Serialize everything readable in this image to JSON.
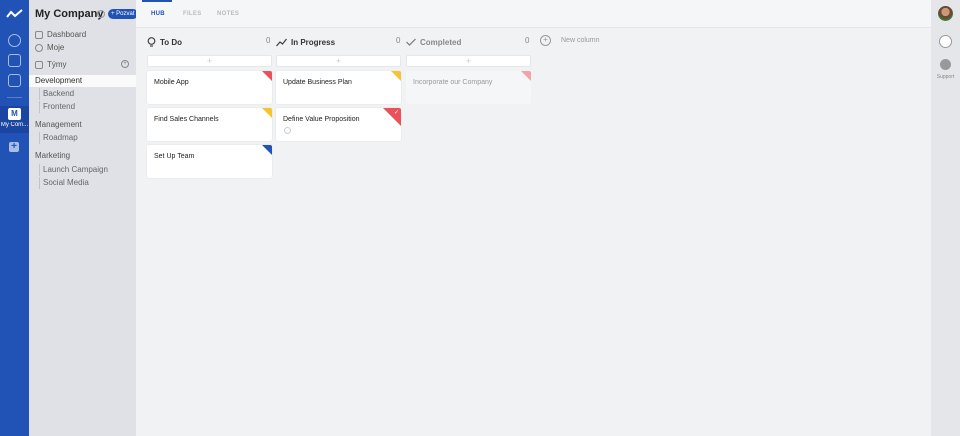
{
  "workspace": {
    "name": "My Company",
    "invite_label": "+ Pozvat",
    "rail_initial": "M",
    "rail_label": "My Com..."
  },
  "sidebar": {
    "dashboard": "Dashboard",
    "mine": "Moje",
    "teams": "Týmy",
    "sections": [
      {
        "name": "Development",
        "items": [
          "Backend",
          "Frontend"
        ]
      },
      {
        "name": "Management",
        "items": [
          "Roadmap"
        ]
      },
      {
        "name": "Marketing",
        "items": [
          "Launch Campaign",
          "Social Media"
        ]
      }
    ]
  },
  "tabs": [
    {
      "label": "HUB"
    },
    {
      "label": "FILES"
    },
    {
      "label": "NOTES"
    }
  ],
  "columns": [
    {
      "title": "To Do",
      "count": "0",
      "icon": "lightbulb-icon",
      "add_label": "+",
      "cards": [
        {
          "title": "Mobile App",
          "color": "#e9525b"
        },
        {
          "title": "Find Sales Channels",
          "color": "#f5c431"
        },
        {
          "title": "Set Up Team",
          "color": "#2152b5"
        }
      ]
    },
    {
      "title": "In Progress",
      "count": "0",
      "icon": "trend-icon",
      "add_label": "+",
      "cards": [
        {
          "title": "Update Business Plan",
          "color": "#f5c431"
        },
        {
          "title": "Define Value Proposition",
          "color": "#e9525b",
          "checked": true
        }
      ]
    },
    {
      "title": "Completed",
      "count": "0",
      "icon": "check-icon",
      "add_label": "+",
      "cards": [
        {
          "title": "Incorporate our Company",
          "color": "#f0a5a8"
        }
      ]
    }
  ],
  "new_column_label": "New column",
  "check_glyph": "✓",
  "support_label": "Support",
  "colors": {
    "brand": "#2152b5",
    "red": "#e9525b",
    "yellow": "#f5c431",
    "blue": "#2152b5"
  }
}
